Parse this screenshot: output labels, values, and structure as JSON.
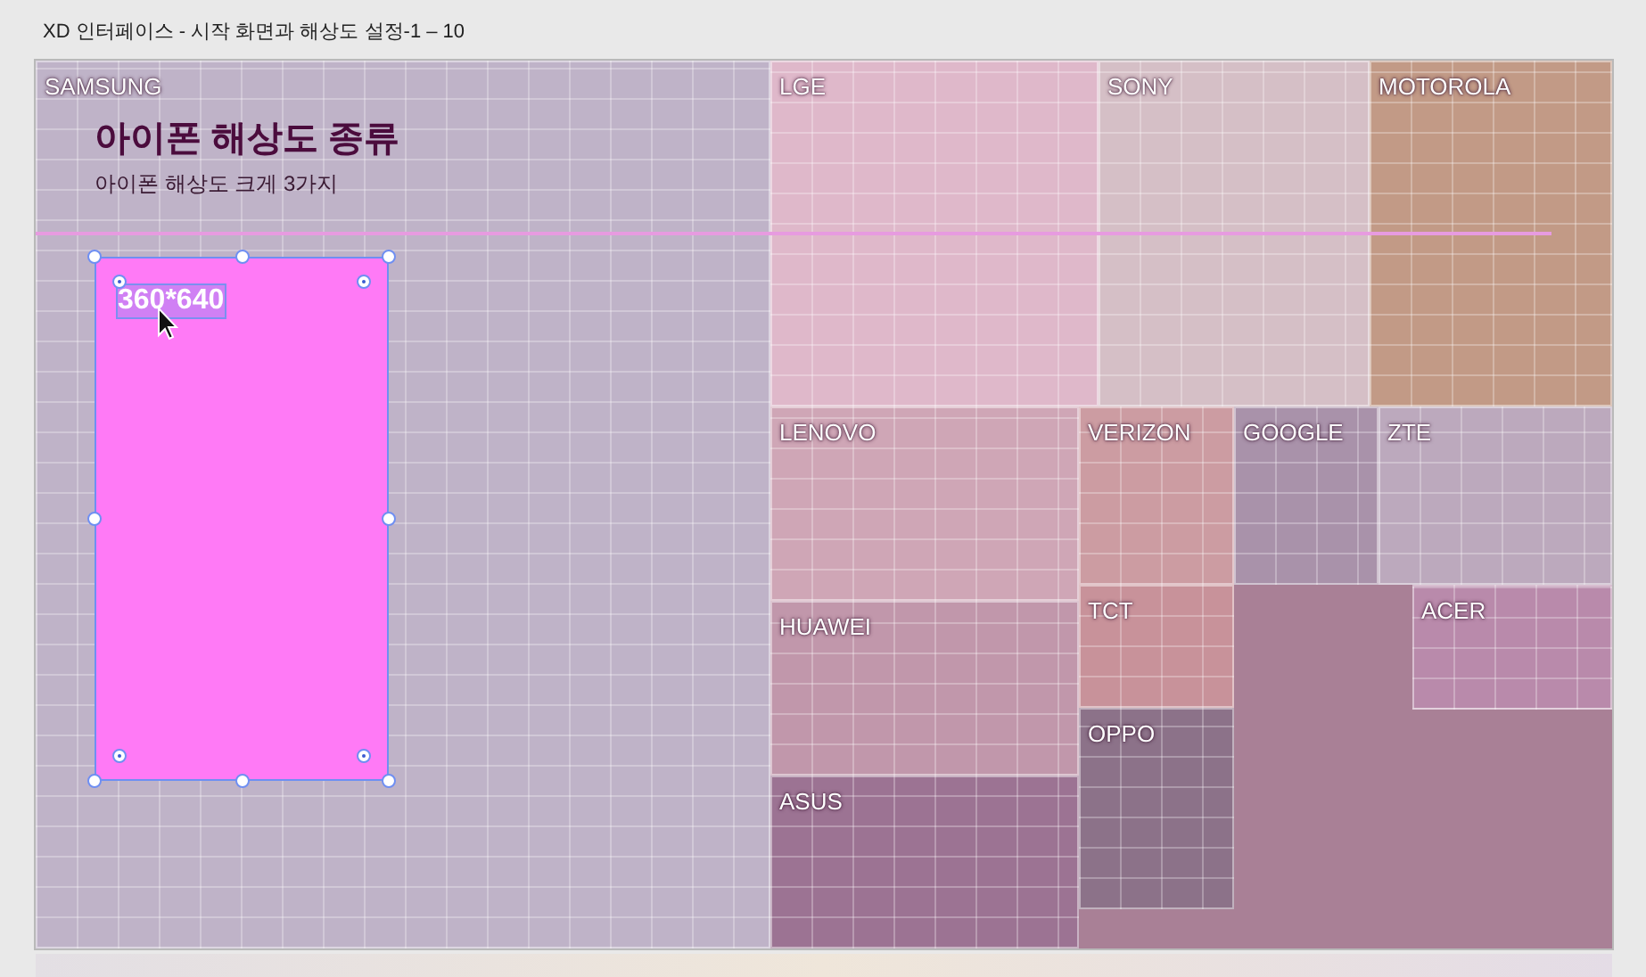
{
  "window": {
    "title": "XD 인터페이스 - 시작 화면과 해상도 설정-1 – 10"
  },
  "artboard": {
    "heading": "아이폰 해상도 종류",
    "subheading": "아이폰 해상도 크게 3가지",
    "selection": {
      "label": "360*640",
      "selected": true
    }
  },
  "treemap": [
    {
      "label": "SAMSUNG",
      "color": "#bfb3c8"
    },
    {
      "label": "LGE",
      "color": "#dfb8ca"
    },
    {
      "label": "SONY",
      "color": "#d5bfc6"
    },
    {
      "label": "MOTOROLA",
      "color": "#c29a86"
    },
    {
      "label": "LENOVO",
      "color": "#cfa6b6"
    },
    {
      "label": "VERIZON",
      "color": "#cc9ca2"
    },
    {
      "label": "GOOGLE",
      "color": "#a992aa"
    },
    {
      "label": "ZTE",
      "color": "#bca9bd"
    },
    {
      "label": "HUAWEI",
      "color": "#c197ab"
    },
    {
      "label": "TCT",
      "color": "#c8929a"
    },
    {
      "label": "ACER",
      "color": "#b98aab"
    },
    {
      "label": "OPPO",
      "color": "#8c7289"
    },
    {
      "label": "ASUS",
      "color": "#9c7393"
    }
  ]
}
